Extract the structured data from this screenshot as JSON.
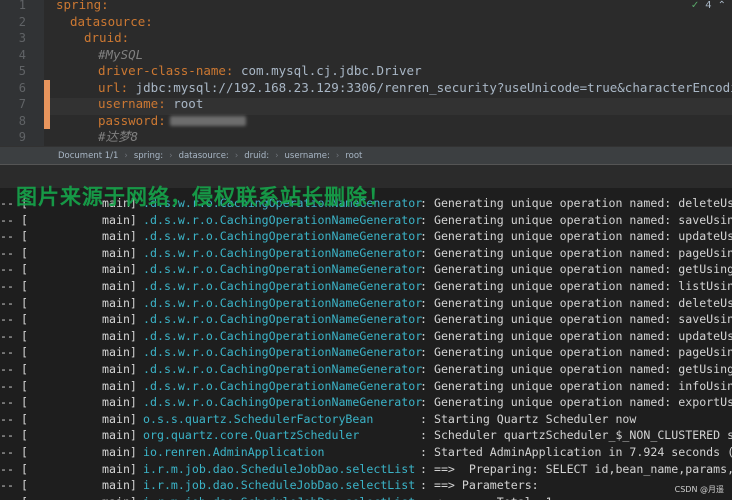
{
  "editor": {
    "inspection": {
      "status": "✓",
      "count": "4"
    },
    "lines": [
      {
        "num": "1",
        "indent": 0,
        "key": "spring:",
        "value": ""
      },
      {
        "num": "2",
        "indent": 1,
        "key": "datasource:",
        "value": ""
      },
      {
        "num": "3",
        "indent": 2,
        "key": "druid:",
        "value": ""
      },
      {
        "num": "4",
        "indent": 3,
        "comment": "#MySQL"
      },
      {
        "num": "5",
        "indent": 3,
        "key": "driver-class-name:",
        "value": " com.mysql.cj.jdbc.Driver"
      },
      {
        "num": "6",
        "indent": 3,
        "key": "url:",
        "value": " jdbc:mysql://192.168.23.129:3306/renren_security?useUnicode=true&characterEncoding=UTF-8&"
      },
      {
        "num": "7",
        "indent": 3,
        "key": "username:",
        "value": " root"
      },
      {
        "num": "8",
        "indent": 3,
        "key": "password:",
        "value": "",
        "blurred": true
      },
      {
        "num": "9",
        "indent": 3,
        "comment": "#达梦8"
      }
    ],
    "modified_lines": [
      6,
      7,
      8
    ]
  },
  "breadcrumbs": [
    "Document 1/1",
    "spring:",
    "datasource:",
    "druid:",
    "username:",
    "root"
  ],
  "watermark": "图片来源于网络，侵权联系站长删除！",
  "console": {
    "rows": [
      {
        "prefix": "-- [",
        "thread": "main]",
        "logger": ".d.s.w.r.o.CachingOperationNameGenerator",
        "message": ": Generating unique operation named: deleteUsi"
      },
      {
        "prefix": "-- [",
        "thread": "main]",
        "logger": ".d.s.w.r.o.CachingOperationNameGenerator",
        "message": ": Generating unique operation named: saveUsing"
      },
      {
        "prefix": "-- [",
        "thread": "main]",
        "logger": ".d.s.w.r.o.CachingOperationNameGenerator",
        "message": ": Generating unique operation named: updateUsi"
      },
      {
        "prefix": "-- [",
        "thread": "main]",
        "logger": ".d.s.w.r.o.CachingOperationNameGenerator",
        "message": ": Generating unique operation named: pageUsing"
      },
      {
        "prefix": "-- [",
        "thread": "main]",
        "logger": ".d.s.w.r.o.CachingOperationNameGenerator",
        "message": ": Generating unique operation named: getUsingG"
      },
      {
        "prefix": "-- [",
        "thread": "main]",
        "logger": ".d.s.w.r.o.CachingOperationNameGenerator",
        "message": ": Generating unique operation named: listUsing"
      },
      {
        "prefix": "-- [",
        "thread": "main]",
        "logger": ".d.s.w.r.o.CachingOperationNameGenerator",
        "message": ": Generating unique operation named: deleteUsi"
      },
      {
        "prefix": "-- [",
        "thread": "main]",
        "logger": ".d.s.w.r.o.CachingOperationNameGenerator",
        "message": ": Generating unique operation named: saveUsing"
      },
      {
        "prefix": "-- [",
        "thread": "main]",
        "logger": ".d.s.w.r.o.CachingOperationNameGenerator",
        "message": ": Generating unique operation named: updateUsi"
      },
      {
        "prefix": "-- [",
        "thread": "main]",
        "logger": ".d.s.w.r.o.CachingOperationNameGenerator",
        "message": ": Generating unique operation named: pageUsing"
      },
      {
        "prefix": "-- [",
        "thread": "main]",
        "logger": ".d.s.w.r.o.CachingOperationNameGenerator",
        "message": ": Generating unique operation named: getUsingG"
      },
      {
        "prefix": "-- [",
        "thread": "main]",
        "logger": ".d.s.w.r.o.CachingOperationNameGenerator",
        "message": ": Generating unique operation named: infoUsing"
      },
      {
        "prefix": "-- [",
        "thread": "main]",
        "logger": ".d.s.w.r.o.CachingOperationNameGenerator",
        "message": ": Generating unique operation named: exportUsi"
      },
      {
        "prefix": "-- [",
        "thread": "main]",
        "logger": "o.s.s.quartz.SchedulerFactoryBean",
        "message": ": Starting Quartz Scheduler now"
      },
      {
        "prefix": "-- [",
        "thread": "main]",
        "logger": "org.quartz.core.QuartzScheduler",
        "message": ": Scheduler quartzScheduler_$_NON_CLUSTERED st"
      },
      {
        "prefix": "-- [",
        "thread": "main]",
        "logger": "io.renren.AdminApplication",
        "message": ": Started AdminApplication in 7.924 seconds (J"
      },
      {
        "prefix": "-- [",
        "thread": "main]",
        "logger": "i.r.m.job.dao.ScheduleJobDao.selectList",
        "message": ": ==>  Preparing: SELECT id,bean_name,params,c"
      },
      {
        "prefix": "-- [",
        "thread": "main]",
        "logger": "i.r.m.job.dao.ScheduleJobDao.selectList",
        "message": ": ==> Parameters:"
      },
      {
        "prefix": "-- [",
        "thread": "main]",
        "logger": "i.r.m.job.dao.ScheduleJobDao.selectList",
        "message": ": <==      Total: 1"
      }
    ]
  },
  "credit": "CSDN @月遥"
}
